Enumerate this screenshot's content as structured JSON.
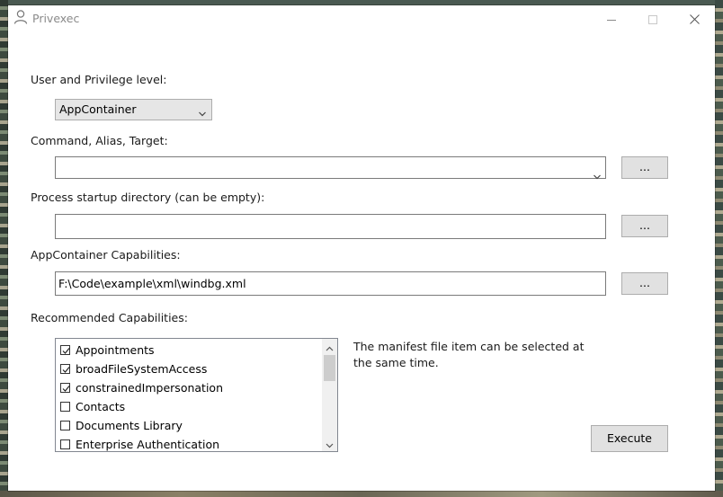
{
  "window": {
    "title": "Privexec"
  },
  "labels": {
    "user_level": "User and Privilege level:",
    "command": "Command, Alias, Target:",
    "startup_dir": "Process startup directory (can be empty):",
    "capabilities": "AppContainer Capabilities:",
    "recommended": "Recommended Capabilities:"
  },
  "user_level_select": {
    "value": "AppContainer"
  },
  "command_field": {
    "value": ""
  },
  "startup_dir_field": {
    "value": ""
  },
  "capabilities_field": {
    "value": "F:\\Code\\example\\xml\\windbg.xml"
  },
  "buttons": {
    "browse_command": "...",
    "browse_dir": "...",
    "browse_caps": "...",
    "execute": "Execute"
  },
  "capability_list": [
    {
      "label": "Appointments",
      "checked": true
    },
    {
      "label": "broadFileSystemAccess",
      "checked": true
    },
    {
      "label": "constrainedImpersonation",
      "checked": true
    },
    {
      "label": "Contacts",
      "checked": false
    },
    {
      "label": "Documents Library",
      "checked": false
    },
    {
      "label": "Enterprise Authentication",
      "checked": false
    }
  ],
  "note": "The manifest file item can be selected at the same time."
}
